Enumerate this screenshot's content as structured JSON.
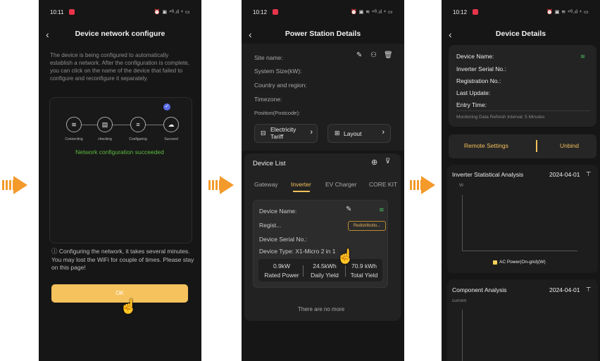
{
  "arrows": [
    "arrow-1",
    "arrow-2",
    "arrow-3"
  ],
  "screen1": {
    "status": {
      "time": "10:11",
      "icons": "⏰ ▣ ⁴ᴳ.ıl ⁴ ▭"
    },
    "title": "Device network configure",
    "description": "The device is being configured to automatically establish a network. After the configuration is complete, you can click on the name of the device that failed to configure and reconfigure it separately.",
    "steps": [
      {
        "label": "Connecting",
        "icon": "wifi-icon"
      },
      {
        "label": "checking",
        "icon": "briefcase-icon"
      },
      {
        "label": "Configuring",
        "icon": "device-icon"
      },
      {
        "label": "Succeed",
        "icon": "cloud-icon"
      }
    ],
    "success_text": "Network configuration succeeded",
    "note": "Configuring the network, it takes several minutes. You may lost the WiFi for couple of times. Please stay on this page!",
    "ok_label": "OK",
    "colors": {
      "accent": "#f6c25d",
      "success": "#5dbb3e",
      "check": "#5b6ee6"
    }
  },
  "screen2": {
    "status": {
      "time": "10:12",
      "icons": "⏰ ▣ ≋ ⁴ᴳ.ıl ⁴ ▭"
    },
    "title": "Power Station Details",
    "fields": [
      "Site name:",
      "System Size(kW):",
      "Country and region:",
      "Timezone:",
      "Position(Postcode):"
    ],
    "tariff_label": "Electricity Tariff",
    "layout_label": "Layout",
    "device_list_title": "Device List",
    "tabs": [
      "Gateway",
      "Inverter",
      "EV Charger",
      "CORE KIT"
    ],
    "active_tab": "Inverter",
    "device": {
      "name_label": "Device Name:",
      "regist_label": "Regist...",
      "redistribution_label": "Redistributio...",
      "serial_label": "Device Serial No.:",
      "type_label": "Device Type: X1-Micro 2 in 1"
    },
    "stats": [
      {
        "value": "0.9kW",
        "label": "Rated Power"
      },
      {
        "value": "24.5kWh",
        "label": "Daily Yield"
      },
      {
        "value": "70.9 kWh",
        "label": "Total Yield"
      }
    ],
    "footer": "There are no more"
  },
  "screen3": {
    "status": {
      "time": "10:12",
      "icons": "⏰ ▣ ≋ ⁴ᴳ.ıl ⁴ ▭"
    },
    "title": "Device Details",
    "rows": [
      "Device Name:",
      "Inverter Serial No.:",
      "Registration No.:",
      "Last Update:",
      "Entry Time:"
    ],
    "refresh_note": "Monitoring Data Refresh Interval: 5 Minutes",
    "remote_settings": "Remote Settings",
    "unbind": "Unbind",
    "inverter_section": {
      "title": "Inverter Statistical Analysis",
      "date": "2024-04-01",
      "unit": "W",
      "legend": "AC Power(On-grid)(W)"
    },
    "component_section": {
      "title": "Component Analysis",
      "date": "2024-04-01",
      "unit": "current"
    }
  }
}
